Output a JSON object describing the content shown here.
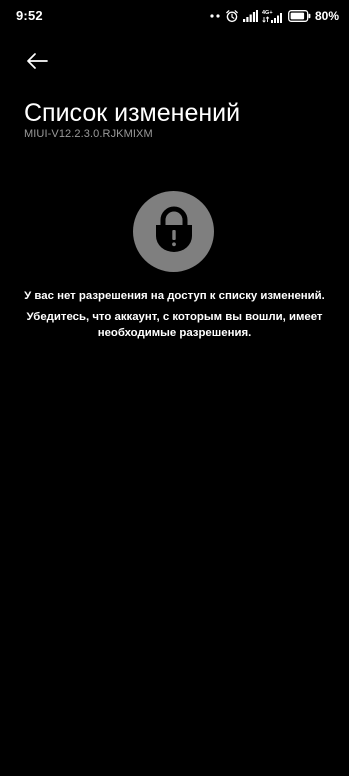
{
  "status_bar": {
    "time": "9:52",
    "battery_percent": "80%",
    "network_label": "4G+",
    "icons": [
      "more-dots-icon",
      "alarm-icon",
      "signal-icon",
      "signal-4g-icon",
      "battery-icon"
    ]
  },
  "header": {
    "back_icon": "arrow-left-icon",
    "title": "Список изменений",
    "subtitle": "MIUI-V12.2.3.0.RJKMIXM"
  },
  "content": {
    "lock_icon": "lock-alert-icon",
    "message_main": "У вас нет разрешения на доступ к списку изменений.",
    "message_detail": "Убедитесь, что аккаунт, с которым вы вошли, имеет необходимые разрешения."
  },
  "colors": {
    "background": "#000000",
    "text": "#ffffff",
    "subtitle": "#9a9a9a",
    "lock_circle": "#7f7f7f"
  }
}
